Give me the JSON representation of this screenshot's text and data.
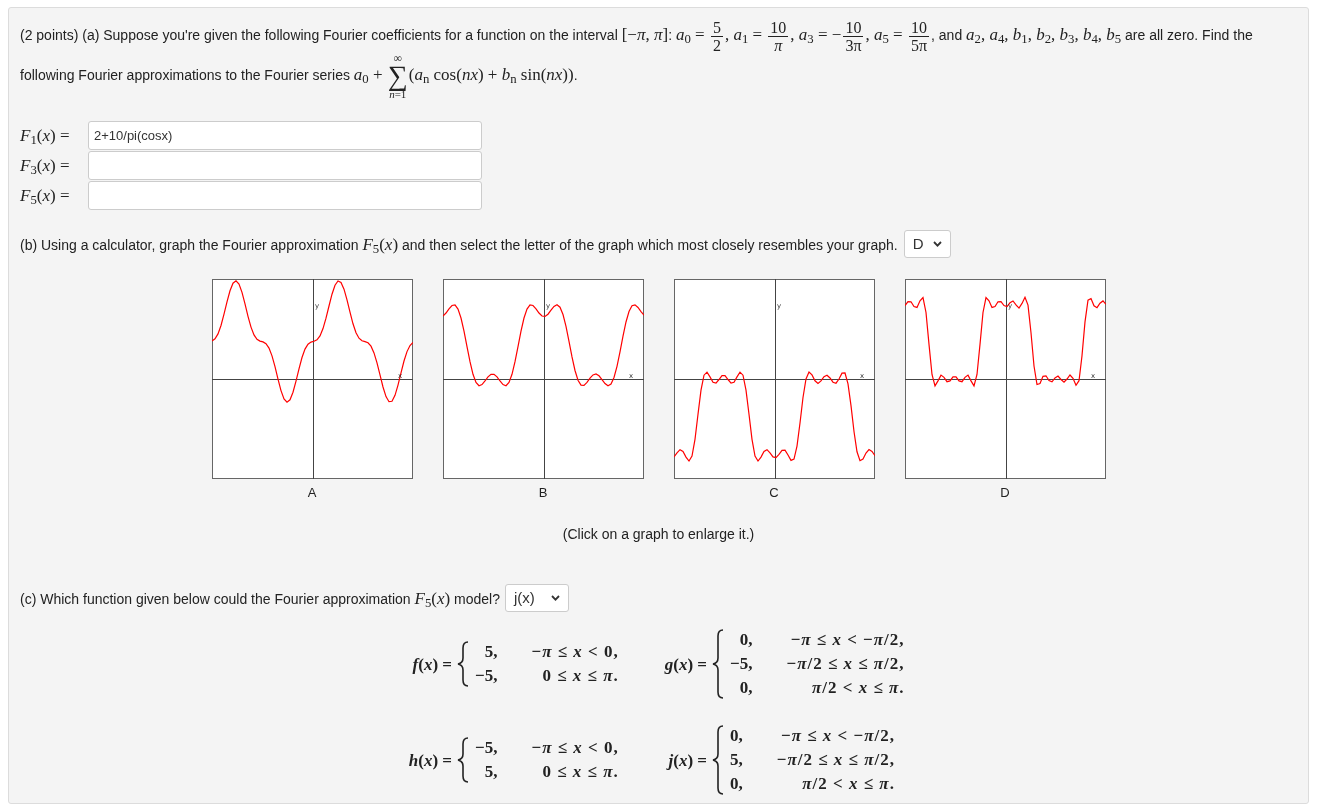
{
  "part_a": {
    "question": [
      {
        "kind": "text",
        "text": "(2 points) (a) Suppose you're given the following Fourier coefficients for a function on the interval "
      },
      {
        "kind": "math",
        "text": "[−*π*, *π*]"
      },
      {
        "kind": "text",
        "text": ": "
      },
      {
        "kind": "math",
        "text": "*a*$_{0}$ = "
      },
      {
        "kind": "frac",
        "numerator": "5",
        "denominator": "2"
      },
      {
        "kind": "math",
        "text": ", *a*$_{1}$ = "
      },
      {
        "kind": "frac",
        "numerator": "10",
        "denominator": "*π*"
      },
      {
        "kind": "math",
        "text": ", *a*$_{3}$ = −"
      },
      {
        "kind": "frac",
        "numerator": "10",
        "denominator": "3π"
      },
      {
        "kind": "math",
        "text": ", *a*$_{5}$ = "
      },
      {
        "kind": "frac",
        "numerator": "10",
        "denominator": "5π"
      },
      {
        "kind": "text",
        "text": ", and "
      },
      {
        "kind": "math",
        "text": "*a*$_{2}$, *a*$_{4}$, *b*$_{1}$, *b*$_{2}$, *b*$_{3}$, *b*$_{4}$, *b*$_{5}$"
      },
      {
        "kind": "text",
        "text": " are all zero. Find the following Fourier approximations to the Fourier series "
      },
      {
        "kind": "math",
        "text": "*a*$_{0}$ + "
      },
      {
        "kind": "sum",
        "symbol": "∑",
        "upper": "∞",
        "lower": "*n*=1"
      },
      {
        "kind": "math",
        "text": "(*a*$_{n}$ cos(*nx*) + *b*$_{n}$ sin(*nx*))"
      },
      {
        "kind": "text",
        "text": "."
      }
    ],
    "answers": [
      {
        "label": "*F*$_{1}$(*x*) =",
        "value": "2+10/pi(cosx)"
      },
      {
        "label": "*F*$_{3}$(*x*) ="
      },
      {
        "label": "*F*$_{5}$(*x*) ="
      }
    ]
  },
  "part_b": {
    "question": [
      {
        "kind": "text",
        "text": "(b) Using a calculator, graph the Fourier approximation "
      },
      {
        "kind": "math",
        "text": "*F*$_{5}$(*x*)"
      },
      {
        "kind": "text",
        "text": " and then select the letter of the graph which most closely resembles your graph."
      }
    ],
    "dropdown": {
      "value": "D"
    },
    "graphs": [
      {
        "label": "A",
        "y_label": "y",
        "x_label": "x"
      },
      {
        "label": "B",
        "y_label": "y",
        "x_label": "x"
      },
      {
        "label": "C",
        "y_label": "y",
        "x_label": "x"
      },
      {
        "label": "D",
        "y_label": "y",
        "x_label": "x"
      }
    ],
    "note": "(Click on a graph to enlarge it.)"
  },
  "part_c": {
    "question": [
      {
        "kind": "text",
        "text": "(c) Which function given below could the Fourier approximation "
      },
      {
        "kind": "math",
        "text": "*F*$_{5}$(*x*)"
      },
      {
        "kind": "text",
        "text": " model?"
      }
    ],
    "dropdown": {
      "value": "j(x)"
    },
    "functions": [
      {
        "name": "*f*(*x*) =",
        "cases": [
          {
            "value": "5,",
            "condition": "−*π* ≤ *x* < 0,"
          },
          {
            "value": "−5,",
            "condition": "0 ≤ *x* ≤ *π*."
          }
        ]
      },
      {
        "name": "*g*(*x*) =",
        "cases": [
          {
            "value": "0,",
            "condition": "−*π* ≤ *x* < −*π*/2,"
          },
          {
            "value": "−5,",
            "condition": "−*π*/2 ≤ *x* ≤ *π*/2,"
          },
          {
            "value": "0,",
            "condition": "*π*/2 < *x* ≤ *π*."
          }
        ]
      },
      {
        "name": "*h*(*x*) =",
        "cases": [
          {
            "value": "−5,",
            "condition": "−*π* ≤ *x* < 0,"
          },
          {
            "value": "5,",
            "condition": "0 ≤ *x* ≤ *π*."
          }
        ]
      },
      {
        "name": "*j*(*x*) =",
        "cases": [
          {
            "value": "0,",
            "condition": "−*π* ≤ *x* < −*π*/2,"
          },
          {
            "value": "5,",
            "condition": "−*π*/2 ≤ *x* ≤ *π*/2,"
          },
          {
            "value": "0,",
            "condition": "*π*/2 < *x* ≤ *π*."
          }
        ]
      }
    ]
  }
}
